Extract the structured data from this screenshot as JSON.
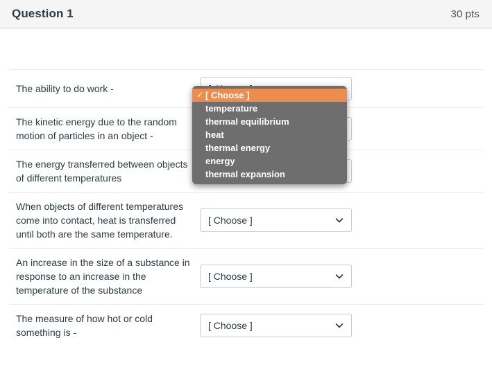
{
  "header": {
    "title": "Question 1",
    "points": "30 pts"
  },
  "select_placeholder": "[ Choose ]",
  "chevron_icon": "chevron-down-icon",
  "rows": [
    {
      "prompt": "The ability to do work -",
      "value": "[ Choose ]"
    },
    {
      "prompt": "The kinetic energy due to the random motion of particles in an object -",
      "value": "[ Choose ]"
    },
    {
      "prompt": "The energy transferred between objects of different temperatures",
      "value": "[ Choose ]"
    },
    {
      "prompt": "When objects of different temperatures come into contact, heat is transferred until both are the same temperature.",
      "value": "[ Choose ]"
    },
    {
      "prompt": "An increase in the size of a substance in response to an increase in the temperature of the substance",
      "value": "[ Choose ]"
    },
    {
      "prompt": "The measure of how hot or cold something is -",
      "value": "[ Choose ]"
    }
  ],
  "dropdown": {
    "open": true,
    "owner_row": 0,
    "highlight_color": "#ed8c4d",
    "background_color": "#6e6e6e",
    "check_glyph": "✓",
    "options": [
      {
        "label": "[ Choose ]",
        "selected": true
      },
      {
        "label": "temperature",
        "selected": false
      },
      {
        "label": "thermal equilibrium",
        "selected": false
      },
      {
        "label": "heat",
        "selected": false
      },
      {
        "label": "thermal energy",
        "selected": false
      },
      {
        "label": "energy",
        "selected": false
      },
      {
        "label": "thermal expansion",
        "selected": false
      }
    ]
  }
}
